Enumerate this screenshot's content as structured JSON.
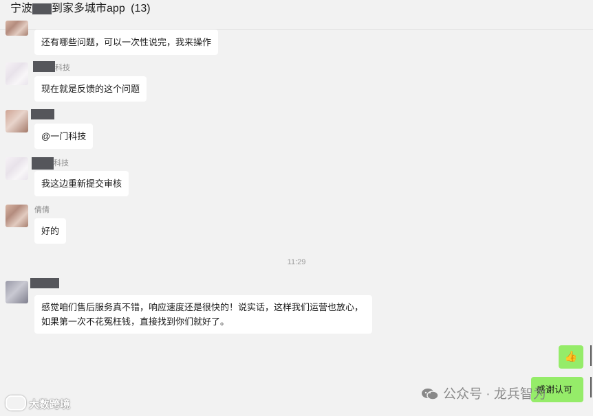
{
  "header": {
    "title_prefix": "宁波",
    "title_suffix": "到家多城市app",
    "member_count": "(13)"
  },
  "messages": [
    {
      "sender": "",
      "text": "还有哪些问题，可以一次性说完，我来操作"
    },
    {
      "sender": "科技",
      "text": "现在就是反馈的这个问题"
    },
    {
      "sender": "",
      "text": "@一门科技"
    },
    {
      "sender": "科技",
      "text": "我这边重新提交审核"
    },
    {
      "sender": "倩倩",
      "text": "好的"
    },
    {
      "sender": "",
      "text": "感觉咱们售后服务真不错，响应速度还是很快的！说实话，这样我们运营也放心，如果第一次不花冤枉钱，直接找到你们就好了。"
    }
  ],
  "timestamp": "11:29",
  "own_messages": [
    {
      "text": "👍"
    },
    {
      "text": "感谢认可"
    }
  ],
  "watermarks": {
    "left": "大数跨境",
    "right": "公众号 · 龙兵智为"
  },
  "colors": {
    "background": "#f2f2f2",
    "bubble_incoming": "#ffffff",
    "bubble_outgoing": "#95ec69"
  }
}
